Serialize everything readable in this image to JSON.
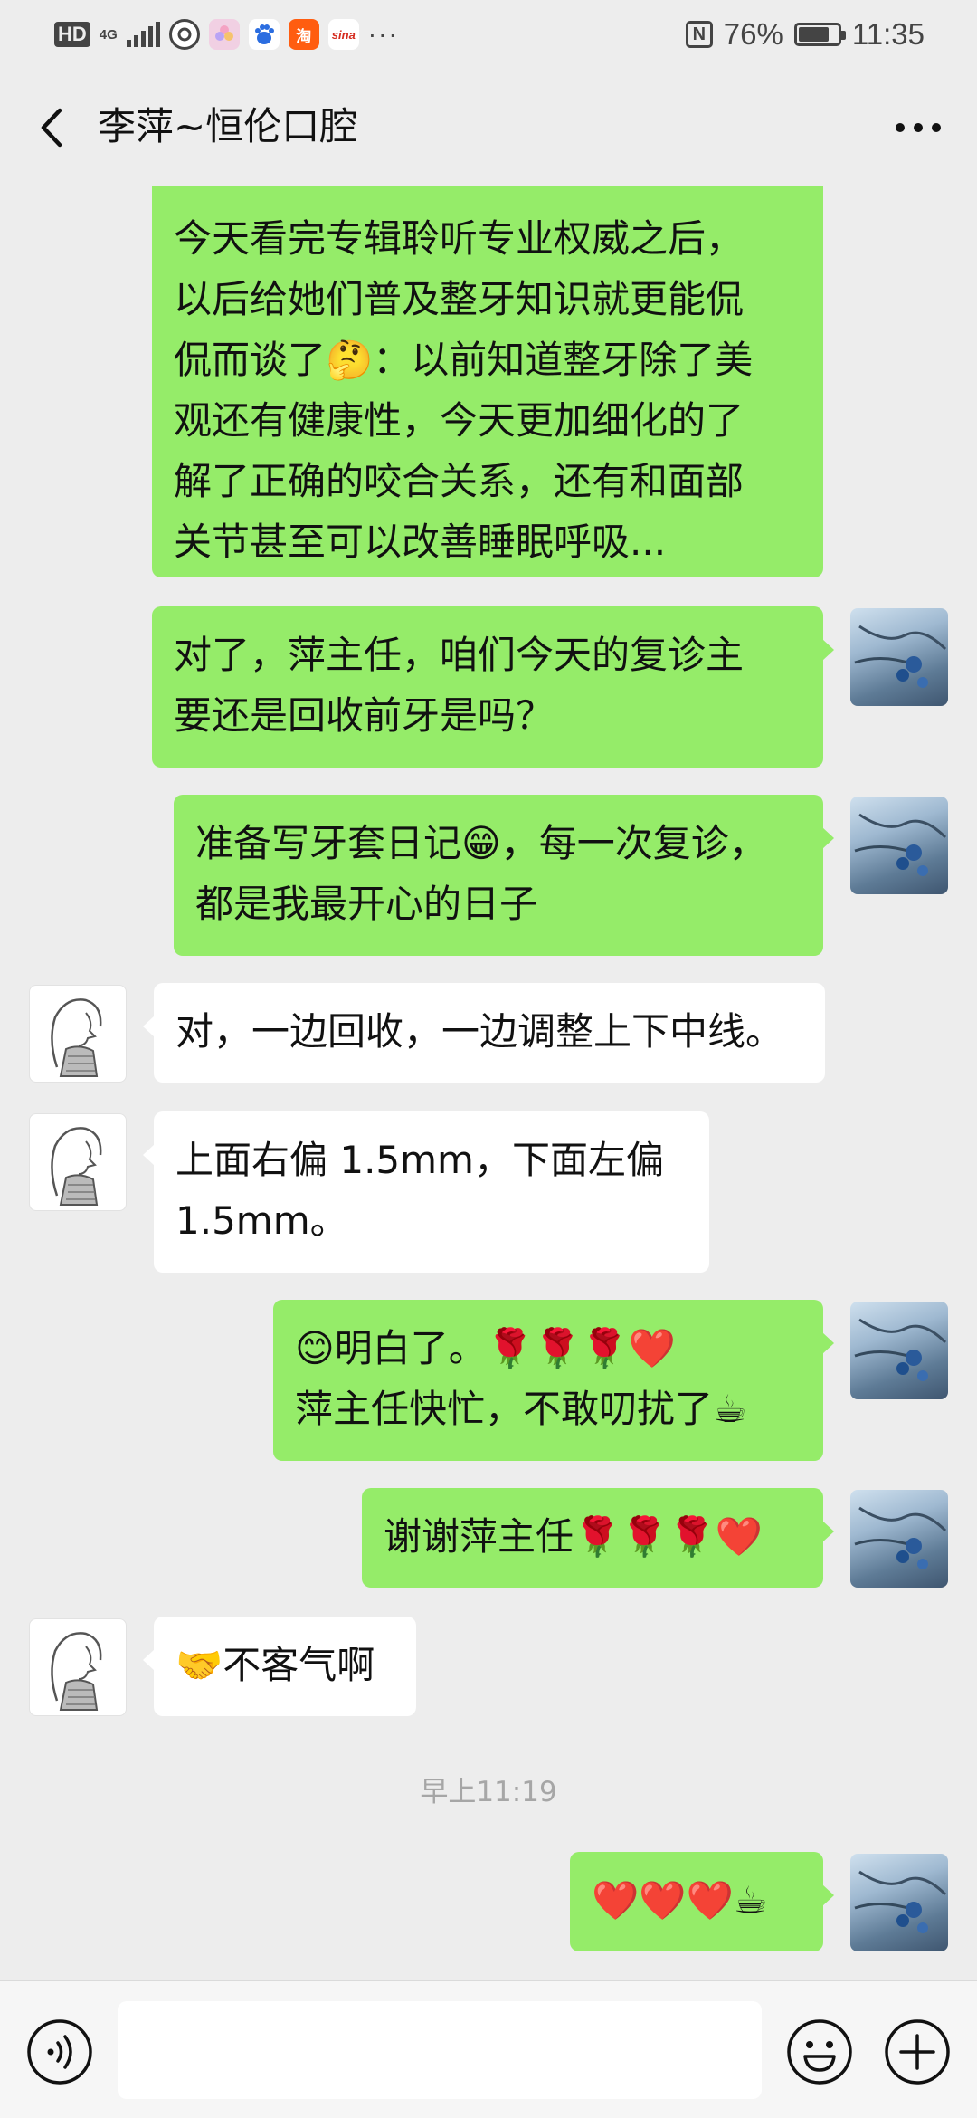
{
  "status_bar": {
    "hd": "HD",
    "network": "4G",
    "battery_text": "76%",
    "battery_level": 0.76,
    "time": "11:35",
    "app_icons": [
      "weibo-circle-icon",
      "photos-icon",
      "baidu-icon",
      "taobao-icon",
      "sina-icon"
    ],
    "taobao_glyph": "淘",
    "sina_glyph": "sina",
    "overflow": "···"
  },
  "header": {
    "title": "李萍~恒伦口腔"
  },
  "messages": [
    {
      "sender": "self",
      "text": "今天看完专辑聆听专业权威之后，\n以后给她们普及整牙知识就更能侃\n侃而谈了🤔：以前知道整牙除了美\n观还有健康性，今天更加细化的了\n解了正确的咬合关系，还有和面部\n关节甚至可以改善睡眠呼吸..."
    },
    {
      "sender": "self",
      "text": "对了，萍主任，咱们今天的复诊主\n要还是回收前牙是吗？"
    },
    {
      "sender": "self",
      "text": "准备写牙套日记😁，每一次复诊，\n都是我最开心的日子"
    },
    {
      "sender": "other",
      "text": "对，一边回收，一边调整上下中线。"
    },
    {
      "sender": "other",
      "text": "上面右偏 1.5mm，下面左偏\n1.5mm。"
    },
    {
      "sender": "self",
      "text": "😊明白了。🌹🌹🌹❤️\n萍主任快忙，不敢叨扰了☕"
    },
    {
      "sender": "self",
      "text": "谢谢萍主任🌹🌹🌹❤️"
    },
    {
      "sender": "other",
      "text": "🤝不客气啊"
    },
    {
      "sender": "self",
      "text": "❤️❤️❤️☕"
    }
  ],
  "timestamp": "早上11:19",
  "colors": {
    "background": "#ededed",
    "self_bubble": "#95ec69",
    "other_bubble": "#ffffff",
    "input_bar": "#f6f6f6"
  }
}
